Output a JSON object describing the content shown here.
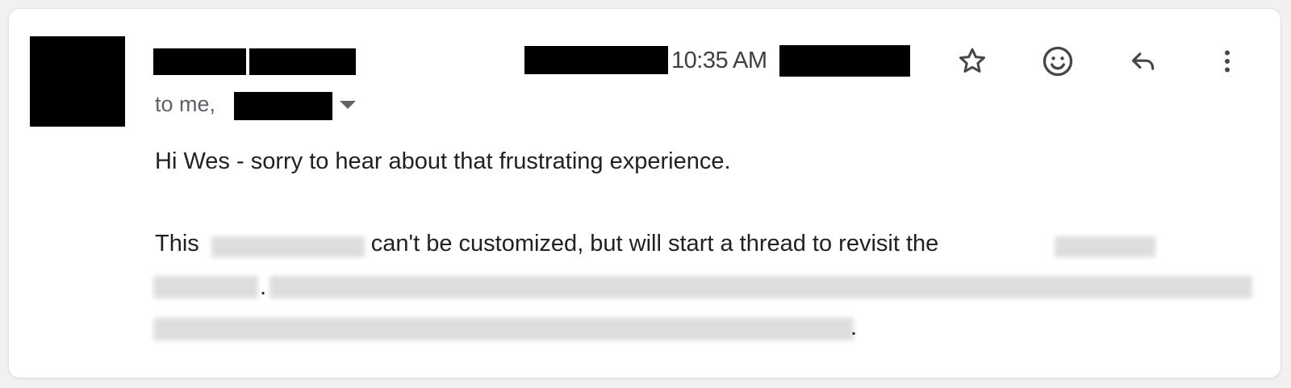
{
  "email": {
    "time": "10:35 AM",
    "to_line": "to me,",
    "body": {
      "line1": "Hi Wes - sorry to hear about that frustrating experience.",
      "line2_start": "This",
      "line2_middle": "can't be customized, but will start a thread to revisit the",
      "period": "."
    }
  },
  "icons": {
    "star": "star-icon",
    "emoji": "emoji-icon",
    "reply": "reply-icon",
    "more": "more-vert-icon"
  }
}
